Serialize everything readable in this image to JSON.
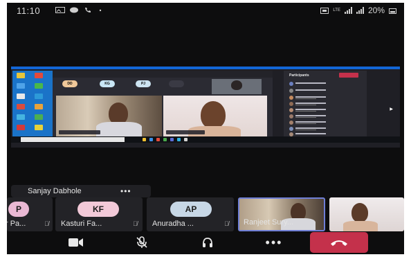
{
  "status_bar": {
    "time": "11:10",
    "network": "LTE",
    "battery": "20%"
  },
  "call": {
    "active_speaker_name": "Sanjay Dabhole",
    "more_label": "•••"
  },
  "thumbnails": [
    {
      "initials": "P",
      "name": "r Pa...",
      "avatar_color": "#e9b8d3"
    },
    {
      "initials": "KF",
      "name": "Kasturi Fa...",
      "avatar_color": "#f2c9d8"
    },
    {
      "initials": "AP",
      "name": "Anuradha ...",
      "avatar_color": "#c7d7e6"
    },
    {
      "initials": "",
      "name": "Ranjeet Sury...",
      "avatar_color": ""
    },
    {
      "initials": "",
      "name": "",
      "avatar_color": ""
    }
  ],
  "controls": {
    "camera_icon": "video-camera-icon",
    "mic_icon": "microphone-off-icon",
    "audio_icon": "headset-icon",
    "more_icon": "more-horizontal-icon",
    "end_icon": "hang-up-icon",
    "more_label": "•••"
  },
  "shared_screen": {
    "bubbles": [
      {
        "initials": "DD",
        "color": "#f0c89a"
      },
      {
        "initials": "KG",
        "color": "#c9e6f5"
      },
      {
        "initials": "PJ",
        "color": "#cde4f2"
      },
      {
        "initials": "",
        "color": "#3a3a44"
      }
    ],
    "panel_title": "Participants"
  },
  "colors": {
    "background": "#0d0d0e",
    "end_call": "#c4314b",
    "tile": "#232327",
    "accent": "#6f7fd6"
  }
}
